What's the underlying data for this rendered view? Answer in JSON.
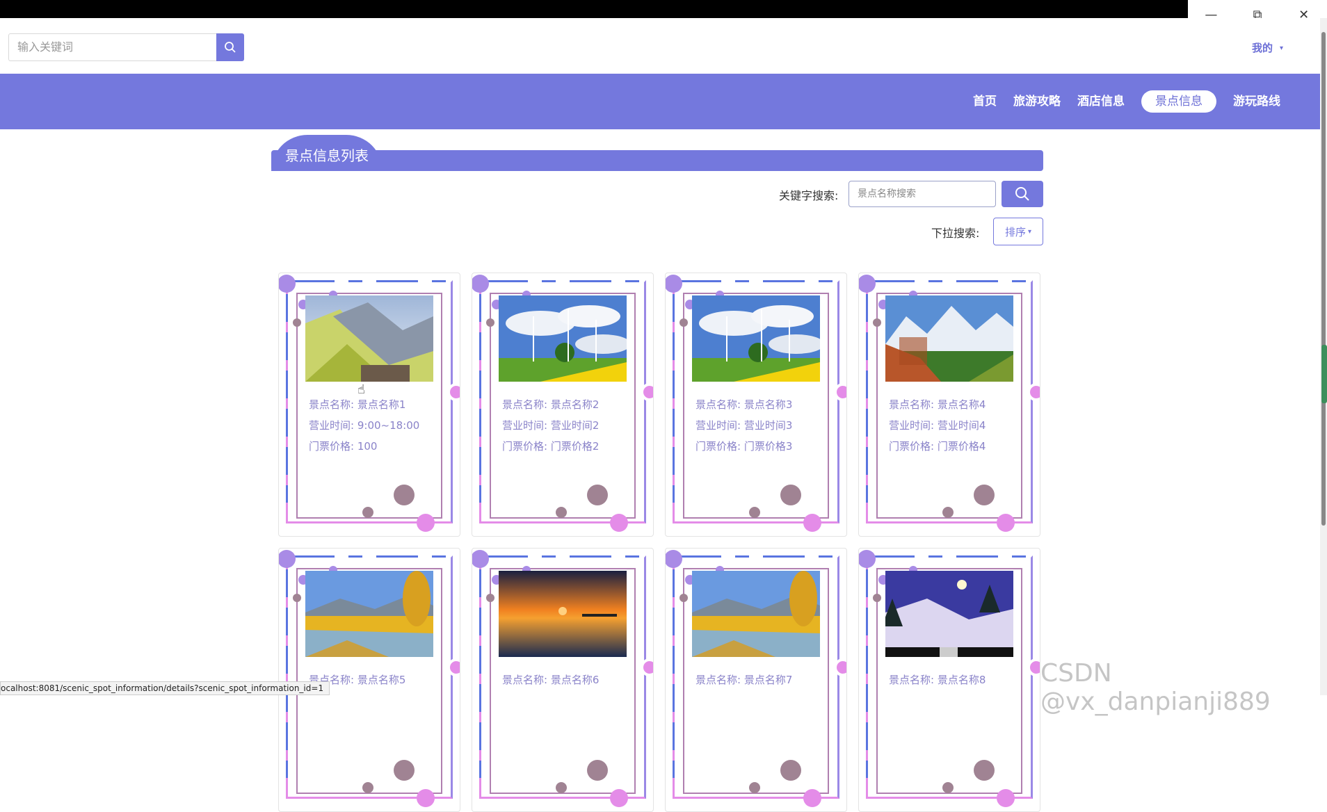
{
  "window": {
    "min_label": "—",
    "restore_label": "⧉",
    "close_label": "✕"
  },
  "topbar": {
    "search_placeholder": "输入关键词",
    "mine_label": "我的",
    "mine_caret": "▾"
  },
  "nav": {
    "items": [
      {
        "label": "首页",
        "active": false
      },
      {
        "label": "旅游攻略",
        "active": false
      },
      {
        "label": "酒店信息",
        "active": false
      },
      {
        "label": "景点信息",
        "active": true
      },
      {
        "label": "游玩路线",
        "active": false
      }
    ]
  },
  "section": {
    "title": "景点信息列表",
    "keyword_label": "关键字搜索:",
    "keyword_placeholder": "景点名称搜索",
    "dropdown_label": "下拉搜索:",
    "sort_label": "排序",
    "sort_caret": "▾"
  },
  "cards": [
    {
      "name_label": "景点名称:",
      "name": "景点名称1",
      "hours_label": "营业时间:",
      "hours": "9:00~18:00",
      "price_label": "门票价格:",
      "price": "100",
      "scene": "valley"
    },
    {
      "name_label": "景点名称:",
      "name": "景点名称2",
      "hours_label": "营业时间:",
      "hours": "营业时间2",
      "price_label": "门票价格:",
      "price": "门票价格2",
      "scene": "windmill"
    },
    {
      "name_label": "景点名称:",
      "name": "景点名称3",
      "hours_label": "营业时间:",
      "hours": "营业时间3",
      "price_label": "门票价格:",
      "price": "门票价格3",
      "scene": "windmill"
    },
    {
      "name_label": "景点名称:",
      "name": "景点名称4",
      "hours_label": "营业时间:",
      "hours": "营业时间4",
      "price_label": "门票价格:",
      "price": "门票价格4",
      "scene": "alps"
    },
    {
      "name_label": "景点名称:",
      "name": "景点名称5",
      "scene": "autumn"
    },
    {
      "name_label": "景点名称:",
      "name": "景点名称6",
      "scene": "sunset"
    },
    {
      "name_label": "景点名称:",
      "name": "景点名称7",
      "scene": "autumn"
    },
    {
      "name_label": "景点名称:",
      "name": "景点名称8",
      "scene": "snow"
    }
  ],
  "status_url": "ocalhost:8081/scenic_spot_information/details?scenic_spot_information_id=1",
  "watermark": "CSDN @vx_danpianji889",
  "colors": {
    "primary": "#7478dd",
    "card_text": "#8a83c9",
    "frame_pink": "#e48ce8",
    "frame_blue": "#5a74e0"
  }
}
